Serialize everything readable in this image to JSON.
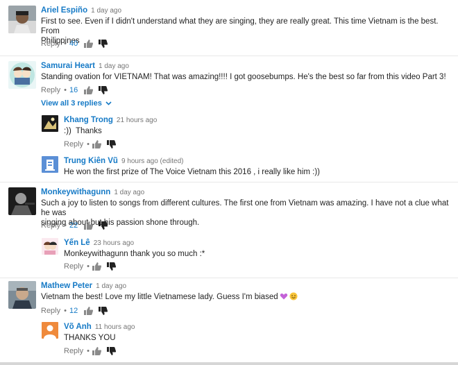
{
  "labels": {
    "reply": "Reply",
    "dot": "•"
  },
  "comments": [
    {
      "author": "Ariel Espiño",
      "time": "1 day ago",
      "text": "First to see. Even if I didn't understand what they are singing, they are really great. This time Vietnam is the best. From\nPhilippines",
      "likes": "40"
    },
    {
      "author": "Samurai Heart",
      "time": "1 day ago",
      "text": "Standing ovation for VIETNAM! That was amazing!!!! I got goosebumps. He's the best so far from this video Part 3!",
      "likes": "16",
      "view_replies": "View all 3 replies",
      "replies": [
        {
          "author": "Khang Trong",
          "time": "21 hours ago",
          "text": ":))  Thanks"
        },
        {
          "author": "Trung Kiên Vũ",
          "time": "9 hours ago (edited)",
          "text": "He won the first prize of The Voice Vietnam this 2016 , i really like him :))"
        }
      ]
    },
    {
      "author": "Monkeywithagunn",
      "time": "1 day ago",
      "text": "Such a joy to listen to songs from different cultures. The first one from Vietnam was amazing. I have not a clue what he was\nsinging about but his passion shone through.",
      "likes": "22",
      "replies": [
        {
          "author": "Yến Lê",
          "time": "23 hours ago",
          "text": "Monkeywithagunn thank you so much :*"
        }
      ]
    },
    {
      "author": "Mathew Peter",
      "time": "1 day ago",
      "text": "Vietnam the best! Love my little Vietnamese lady. Guess I'm biased",
      "likes": "12",
      "replies": [
        {
          "author": "Võ Anh",
          "time": "11 hours ago",
          "text": "THANKS YOU"
        }
      ]
    }
  ],
  "colors": {
    "author": "#167ac6",
    "meta": "#767676",
    "text": "#222222"
  },
  "icons": {
    "like": "thumbs-up-icon",
    "dislike": "thumbs-down-icon",
    "chevron": "chevron-down-icon",
    "emoji": "hearts-and-smile-emoji"
  }
}
